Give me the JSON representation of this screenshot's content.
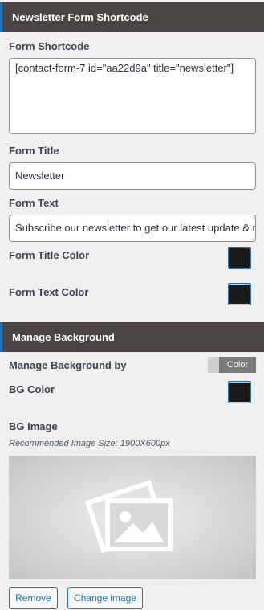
{
  "newsletter_section": {
    "title": "Newsletter Form Shortcode",
    "shortcode_label": "Form Shortcode",
    "shortcode_value": "[contact-form-7 id=\"aa22d9a\" title=\"newsletter\"]",
    "form_title_label": "Form Title",
    "form_title_value": "Newsletter",
    "form_text_label": "Form Text",
    "form_text_value": "Subscribe our newsletter to get our latest update & news",
    "title_color_label": "Form Title Color",
    "title_color": "#1a1a1a",
    "text_color_label": "Form Text Color",
    "text_color": "#1a1a1a"
  },
  "background_section": {
    "title": "Manage Background",
    "manage_by_label": "Manage Background by",
    "manage_by_value": "Color",
    "bg_color_label": "BG Color",
    "bg_color": "#1a1a1a",
    "bg_image_label": "BG Image",
    "image_hint": "Recommended Image Size: 1900X600px",
    "placeholder_icon": "image-placeholder-icon",
    "remove_label": "Remove",
    "change_image_label": "Change image"
  },
  "colors": {
    "header_bg": "#4a4443",
    "accent": "#2271b1",
    "page_bg": "#f0f0f1"
  }
}
